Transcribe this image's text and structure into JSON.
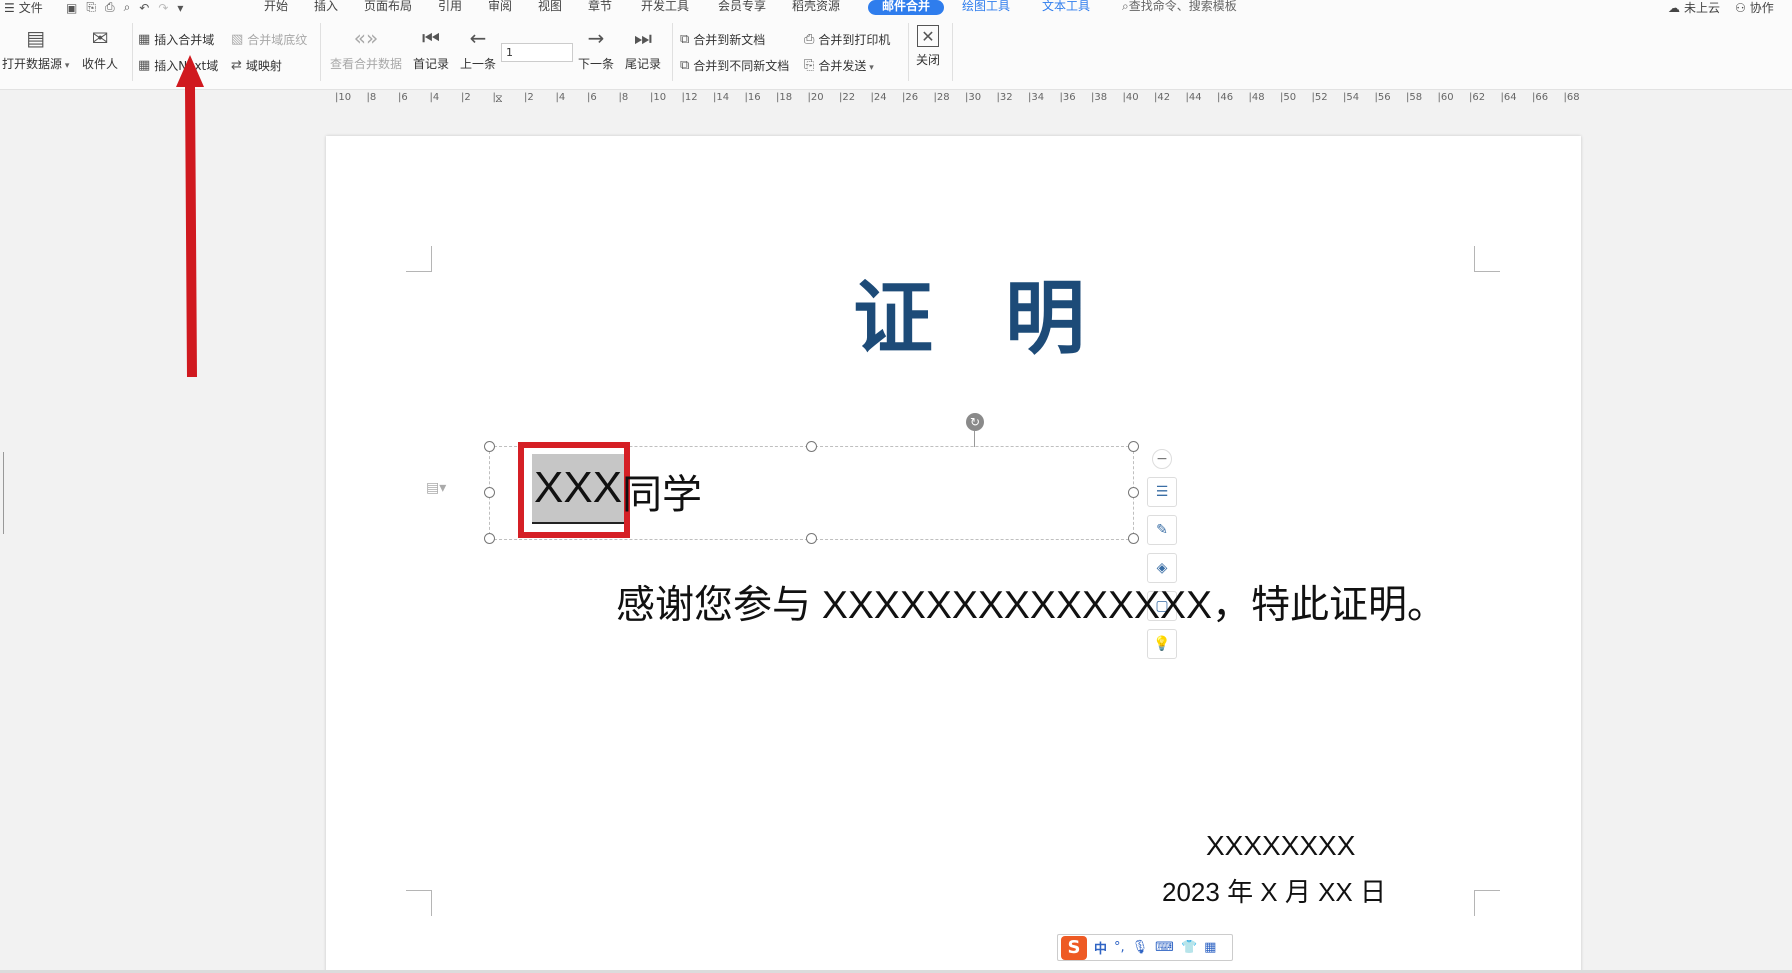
{
  "menu": {
    "file": "文件",
    "tabs": [
      "开始",
      "插入",
      "页面布局",
      "引用",
      "审阅",
      "视图",
      "章节",
      "开发工具",
      "会员专享",
      "稻壳资源"
    ],
    "active_tab": "邮件合并",
    "context_tabs": [
      "绘图工具",
      "文本工具"
    ],
    "search": "查找命令、搜索模板",
    "cloud": "未上云",
    "collab": "协作"
  },
  "ribbon": {
    "open_source": "打开数据源",
    "recipients": "收件人",
    "insert_field": "插入合并域",
    "insert_next_field": "插入Next域",
    "merge_shading": "合并域底纹",
    "field_map": "域映射",
    "view_data": "查看合并数据",
    "first": "首记录",
    "prev": "上一条",
    "record_no": "1",
    "next": "下一条",
    "last": "尾记录",
    "merge_new_doc": "合并到新文档",
    "merge_diff_docs": "合并到不同新文档",
    "merge_printer": "合并到打印机",
    "merge_send": "合并发送",
    "close": "关闭"
  },
  "ruler": [
    "10",
    "8",
    "6",
    "4",
    "2",
    "",
    "2",
    "4",
    "6",
    "8",
    "10",
    "12",
    "14",
    "16",
    "18",
    "20",
    "22",
    "24",
    "26",
    "28",
    "30",
    "32",
    "34",
    "36",
    "38",
    "40",
    "42",
    "44",
    "46",
    "48",
    "50",
    "52",
    "54",
    "56",
    "58",
    "60",
    "62",
    "64",
    "66",
    "68"
  ],
  "doc": {
    "title_a": "证",
    "title_b": "明",
    "field": "XXX",
    "field_suffix": "同学",
    "body": "感谢您参与 XXXXXXXXXXXXXXX，特此证明。",
    "signer": "XXXXXXXX",
    "date": "2023 年 X 月 XX 日"
  },
  "ime": {
    "logo": "S",
    "lang": "中"
  },
  "colors": {
    "accent": "#2f7ded",
    "title": "#1d4b78",
    "highlight": "#d51f25"
  }
}
